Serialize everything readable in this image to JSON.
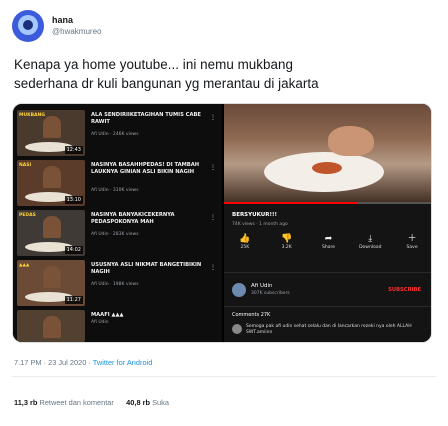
{
  "author": {
    "display_name": "hana",
    "handle": "@hwakmureo"
  },
  "tweet": {
    "line1": "Kenapa ya home youtube... ini nemu mukbang",
    "line2": "sederhana dr kuli bangunan yg merantau di jakarta"
  },
  "media_left": {
    "videos": [
      {
        "tag": "MUKBANG",
        "title": "ALA SENDIRIIKETAGIHAN TUMIS CABE RAWIT",
        "meta": "Afi Udin · 246K views",
        "duration": "12:43"
      },
      {
        "tag": "NASI",
        "title": "NASINYA BASAHHPEDAS! DI TAMBAH LAUKNYA GINIAN ASLI BIKIN NAGIH",
        "meta": "Afi Udin · 310K views",
        "duration": "13:10"
      },
      {
        "tag": "PEDAS",
        "title": "NASINYA BANYAKICEKERNYA PEDASPOKONYA MAH",
        "meta": "Afi Udin · 283K views",
        "duration": "14:02"
      },
      {
        "tag": "▲▲▲",
        "title": "USUSNYA ASLI NIKMAT BANGETIBIKIN NAGIH",
        "meta": "Afi Udin · 198K views",
        "duration": "11:27"
      },
      {
        "tag": "",
        "title": "MAAFI ▲▲▲",
        "meta": "Afi Udin",
        "duration": ""
      }
    ]
  },
  "media_right": {
    "video_title": "BERSYUKUR!!!",
    "views": "74K views · 1 month ago",
    "progress": 0.64,
    "actions": [
      {
        "icon": "thumbs-up-icon",
        "glyph": "👍",
        "label": "25K"
      },
      {
        "icon": "thumbs-down-icon",
        "glyph": "👎",
        "label": "3.2K"
      },
      {
        "icon": "share-icon",
        "glyph": "➦",
        "label": "Share"
      },
      {
        "icon": "download-icon",
        "glyph": "⤓",
        "label": "Download"
      },
      {
        "icon": "save-icon",
        "glyph": "＋",
        "label": "Save"
      }
    ],
    "channel_name": "Afi Udin",
    "channel_subs": "307K subscribers",
    "subscribe_label": "SUBSCRIBE",
    "comments_label": "Comments 27K",
    "top_comment": "Semoga pak afi udin sehat selalu dan di lancarkan rezeki nya oleh ALLAH SWT.amiinn"
  },
  "meta": {
    "datetime": "7.17 PM · 23 Jul 2020 · ",
    "source": "Twitter for Android"
  },
  "stats": {
    "retweets": "11,3 rb",
    "retweets_label": "Retweet dan komentar",
    "likes": "40,8 rb",
    "likes_label": "Suka"
  },
  "colors": {
    "link": "#1b95e0",
    "youtube_red": "#ff0000",
    "text_secondary": "#657786"
  }
}
